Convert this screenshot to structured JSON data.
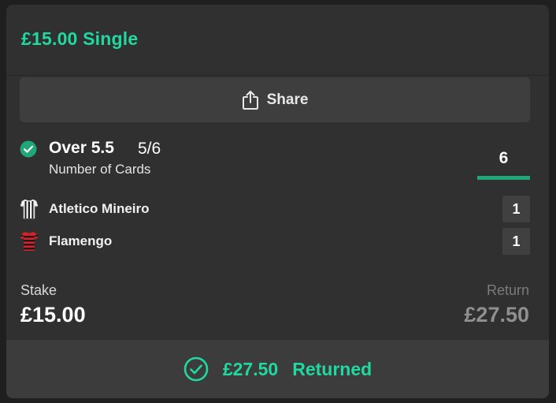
{
  "bet": {
    "title": "£15.00 Single"
  },
  "share": {
    "label": "Share",
    "icon": "share-icon"
  },
  "selection": {
    "name": "Over 5.5",
    "odds": "5/6",
    "market": "Number of Cards",
    "result_value": "6",
    "status_icon": "check-circle-icon"
  },
  "teams": [
    {
      "name": "Atletico Mineiro",
      "score": "1",
      "kit_icon": "striped-kit-icon"
    },
    {
      "name": "Flamengo",
      "score": "1",
      "kit_icon": "striped-kit-icon"
    }
  ],
  "stake": {
    "label": "Stake",
    "value": "£15.00"
  },
  "return": {
    "label": "Return",
    "value": "£27.50"
  },
  "footer": {
    "amount": "£27.50",
    "status": "Returned",
    "icon": "check-circle-outline-icon"
  },
  "colors": {
    "accent": "#1fd9a0",
    "result_bar": "#1fa877",
    "card_bg": "#2f302f",
    "page_bg": "#1e1f1e"
  }
}
